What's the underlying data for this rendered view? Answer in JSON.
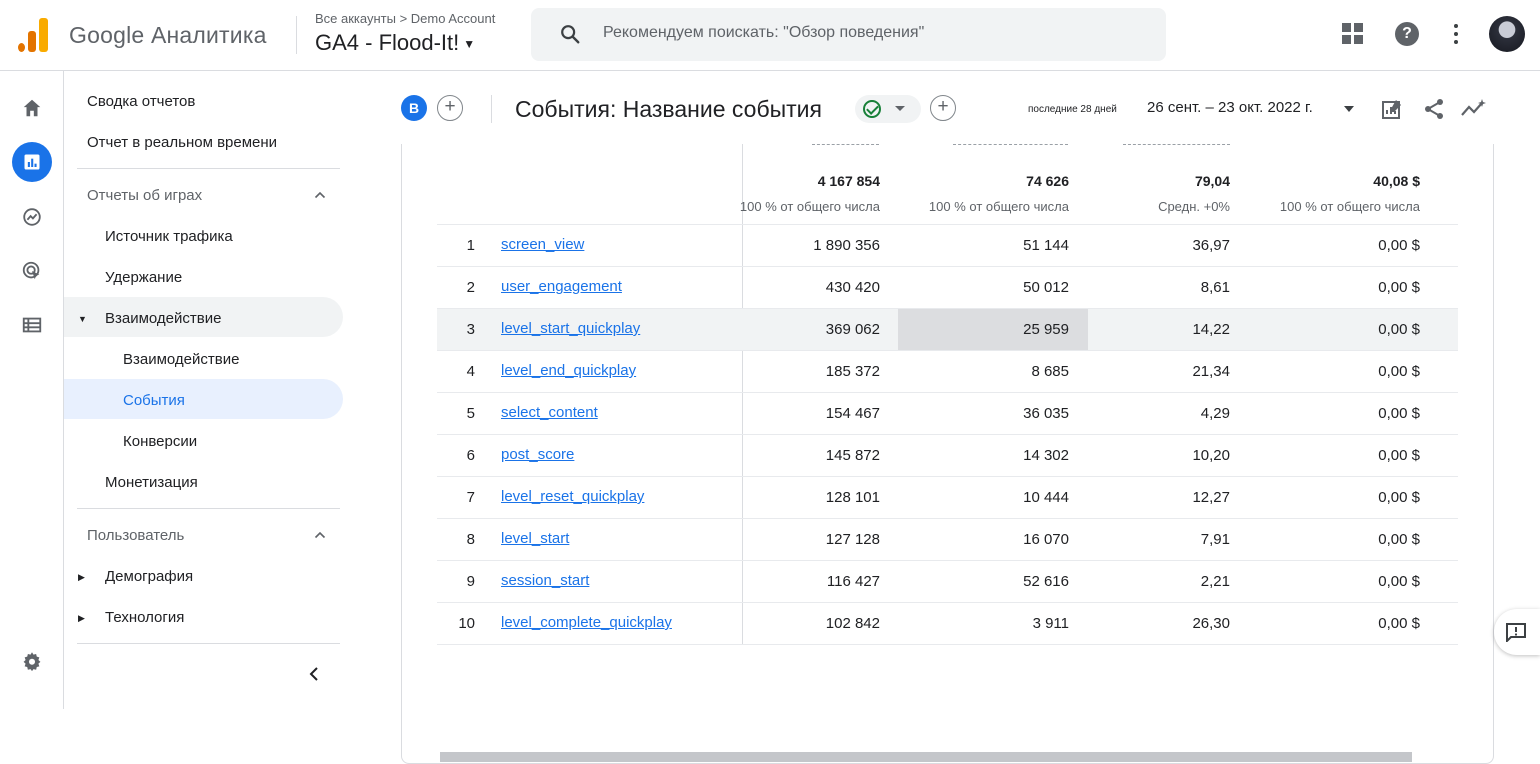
{
  "topbar": {
    "brand": "Google Аналитика",
    "breadcrumb": "Все аккаунты > Demo Account",
    "account": "GA4 - Flood-It!",
    "search_placeholder": "Рекомендуем поискать: \"Обзор поведения\""
  },
  "nav": {
    "summary": "Сводка отчетов",
    "realtime": "Отчет в реальном времени",
    "games_section": "Отчеты об играх",
    "traffic": "Источник трафика",
    "retention": "Удержание",
    "engagement_group": "Взаимодействие",
    "engagement": "Взаимодействие",
    "events": "События",
    "conversions": "Конверсии",
    "monetization": "Монетизация",
    "user_section": "Пользователь",
    "demography": "Демография",
    "technology": "Технология"
  },
  "header": {
    "badge": "B",
    "title": "События: Название события",
    "range_label": "последние 28 дней",
    "range": "26 сент. – 23 окт. 2022 г."
  },
  "totals": [
    {
      "value": "4 167 854",
      "sub": "100 % от общего числа"
    },
    {
      "value": "74 626",
      "sub": "100 % от общего числа"
    },
    {
      "value": "79,04",
      "sub": "Средн. +0%"
    },
    {
      "value": "40,08 $",
      "sub": "100 % от общего числа"
    }
  ],
  "rows": [
    {
      "i": "1",
      "name": "screen_view",
      "a": "1 890 356",
      "b": "51 144",
      "c": "36,97",
      "d": "0,00 $"
    },
    {
      "i": "2",
      "name": "user_engagement",
      "a": "430 420",
      "b": "50 012",
      "c": "8,61",
      "d": "0,00 $"
    },
    {
      "i": "3",
      "name": "level_start_quickplay",
      "a": "369 062",
      "b": "25 959",
      "c": "14,22",
      "d": "0,00 $"
    },
    {
      "i": "4",
      "name": "level_end_quickplay",
      "a": "185 372",
      "b": "8 685",
      "c": "21,34",
      "d": "0,00 $"
    },
    {
      "i": "5",
      "name": "select_content",
      "a": "154 467",
      "b": "36 035",
      "c": "4,29",
      "d": "0,00 $"
    },
    {
      "i": "6",
      "name": "post_score",
      "a": "145 872",
      "b": "14 302",
      "c": "10,20",
      "d": "0,00 $"
    },
    {
      "i": "7",
      "name": "level_reset_quickplay",
      "a": "128 101",
      "b": "10 444",
      "c": "12,27",
      "d": "0,00 $"
    },
    {
      "i": "8",
      "name": "level_start",
      "a": "127 128",
      "b": "16 070",
      "c": "7,91",
      "d": "0,00 $"
    },
    {
      "i": "9",
      "name": "session_start",
      "a": "116 427",
      "b": "52 616",
      "c": "2,21",
      "d": "0,00 $"
    },
    {
      "i": "10",
      "name": "level_complete_quickplay",
      "a": "102 842",
      "b": "3 911",
      "c": "26,30",
      "d": "0,00 $"
    }
  ],
  "colors": {
    "accent": "#1a73e8",
    "active_nav_bg": "#e8f0fe",
    "hover_row": "#f1f3f4"
  }
}
